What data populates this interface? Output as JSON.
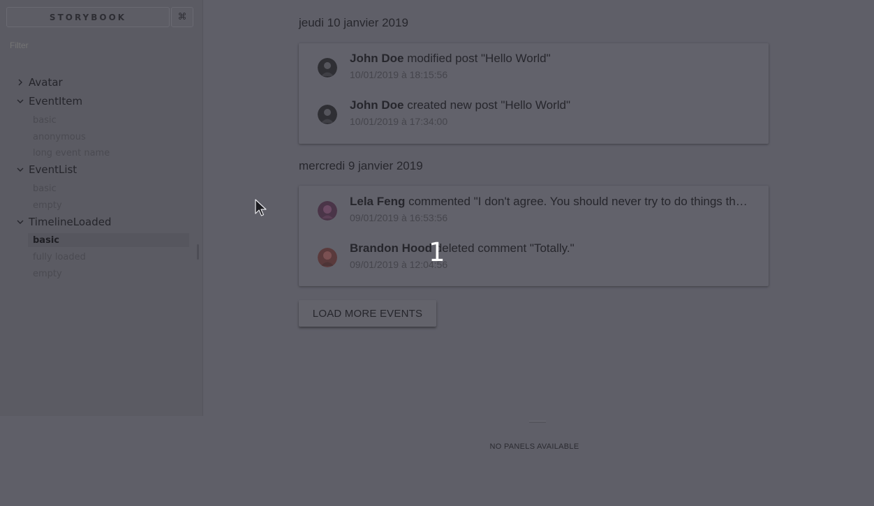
{
  "sidebar": {
    "brand_label": "STORYBOOK",
    "shortcut_label": "⌘",
    "filter_placeholder": "Filter",
    "kinds": [
      {
        "label": "Avatar",
        "expanded": false,
        "stories": []
      },
      {
        "label": "EventItem",
        "expanded": true,
        "stories": [
          "basic",
          "anonymous",
          "long event name"
        ]
      },
      {
        "label": "EventList",
        "expanded": true,
        "stories": [
          "basic",
          "empty"
        ]
      },
      {
        "label": "TimelineLoaded",
        "expanded": true,
        "stories": [
          "basic",
          "fully loaded",
          "empty"
        ],
        "selected_story": "basic"
      }
    ]
  },
  "preview": {
    "days": [
      {
        "title": "jeudi 10 janvier 2019",
        "events": [
          {
            "author": "John Doe",
            "action": "modified post \"Hello World\"",
            "date": "10/01/2019 à 18:15:56"
          },
          {
            "author": "John Doe",
            "action": "created new post \"Hello World\"",
            "date": "10/01/2019 à 17:34:00"
          }
        ]
      },
      {
        "title": "mercredi 9 janvier 2019",
        "events": [
          {
            "author": "Lela Feng",
            "action": "commented \"I don't agree. You should never try to do things this way.\"",
            "date": "09/01/2019 à 16:53:56"
          },
          {
            "author": "Brandon Hood",
            "action": "deleted comment \"Totally.\"",
            "date": "09/01/2019 à 12:04:56"
          }
        ]
      }
    ],
    "load_more_label": "LOAD MORE EVENTS"
  },
  "panel": {
    "empty_label": "NO PANELS AVAILABLE"
  },
  "overlay": {
    "step_number": "1"
  },
  "colors": {
    "overlay_tint": "#5f5f68",
    "text_dark": "#26262c"
  }
}
